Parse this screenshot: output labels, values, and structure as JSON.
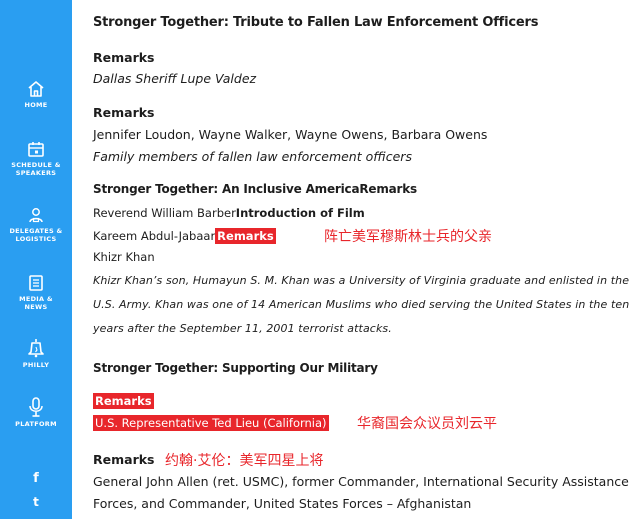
{
  "sidebar": {
    "items": [
      {
        "label": "HOME",
        "icon": "home-icon"
      },
      {
        "label_l1": "SCHEDULE &",
        "label_l2": "SPEAKERS",
        "icon": "calendar-icon"
      },
      {
        "label_l1": "DELEGATES &",
        "label_l2": "LOGISTICS",
        "icon": "badge-icon"
      },
      {
        "label_l1": "MEDIA &",
        "label_l2": "NEWS",
        "icon": "newspaper-icon"
      },
      {
        "label": "PHILLY",
        "icon": "liberty-bell-icon"
      },
      {
        "label": "PLATFORM",
        "icon": "microphone-icon"
      }
    ],
    "social": {
      "facebook": "f",
      "twitter": "t"
    },
    "colors": {
      "background": "#2a9ef1",
      "text": "#ffffff"
    }
  },
  "content": {
    "section1_title": "Stronger Together: Tribute to Fallen Law Enforcement Officers",
    "remarks1_label": "Remarks",
    "remarks1_speaker": "Dallas Sheriff Lupe Valdez",
    "remarks2_label": "Remarks",
    "remarks2_speakers": "Jennifer Loudon, Wayne Walker, Wayne Owens, Barbara Owens",
    "remarks2_desc": "Family members of fallen law enforcement officers",
    "section2_title_a": "Stronger Together: An Inclusive America",
    "section2_title_b": "Remarks",
    "barber_name": "Reverend William Barber",
    "film_intro": "Introduction of Film",
    "kareem_name": "Kareem Abdul-Jabaar",
    "kareem_remarks": "Remarks",
    "khan_name": "Khizr Khan",
    "khan_bio_l1": "Khizr Khan’s son, Humayun S. M. Khan was a University of Virginia graduate and enlisted in the",
    "khan_bio_l2": "U.S. Army. Khan was one of 14 American Muslims who died serving the United States in the ten",
    "khan_bio_l3": "years after the September 11, 2001 terrorist attacks.",
    "section3_title": "Stronger Together: Supporting Our Military",
    "lieu_remarks": "Remarks",
    "lieu_name": "U.S. Representative Ted Lieu (California)",
    "allen_remarks": "Remarks",
    "allen_l1": "General John Allen (ret. USMC), former Commander, International Security Assistance",
    "allen_l2": "Forces, and Commander, United States Forces – Afghanistan"
  },
  "annotations": {
    "khan_note": "阵亡美军穆斯林士兵的父亲",
    "lieu_note": "华裔国会众议员刘云平",
    "allen_note": "约翰·艾伦：美军四星上将",
    "color": "#e8262b"
  }
}
